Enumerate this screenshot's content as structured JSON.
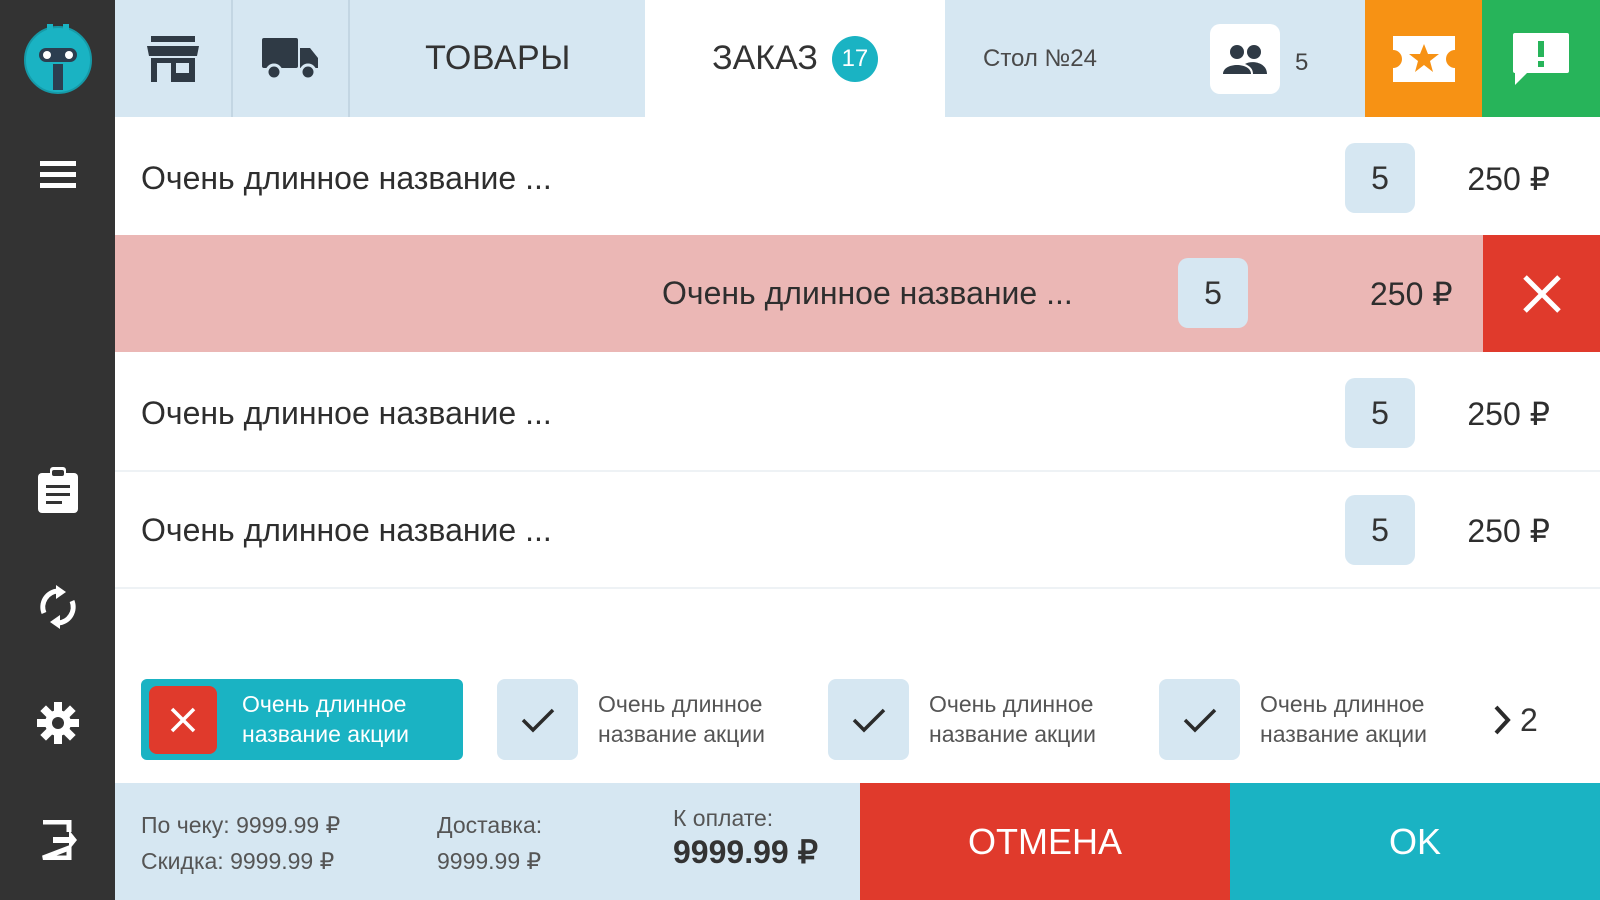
{
  "sidebar": {
    "logo": "robot-logo",
    "items": [
      {
        "icon": "menu-icon"
      },
      {
        "icon": "clipboard-icon"
      },
      {
        "icon": "sync-icon"
      },
      {
        "icon": "gear-icon"
      },
      {
        "icon": "logout-icon"
      }
    ]
  },
  "topbar": {
    "store_icon": "store-icon",
    "delivery_icon": "truck-icon",
    "goods_tab": "ТОВАРЫ",
    "order_tab": "ЗАКАЗ",
    "order_count": "17",
    "table_label": "Стол №24",
    "guests_icon": "people-icon",
    "guests_count": "5",
    "favorite_icon": "star-ticket-icon",
    "message_icon": "message-alert-icon"
  },
  "order_items": [
    {
      "name": "Очень длинное название ...",
      "qty": "5",
      "price": "250 ₽"
    },
    {
      "name": "Очень длинное название ...",
      "qty": "5",
      "price": "250 ₽",
      "swiped": true
    },
    {
      "name": "Очень длинное название ...",
      "qty": "5",
      "price": "250 ₽"
    },
    {
      "name": "Очень длинное название ...",
      "qty": "5",
      "price": "250 ₽"
    }
  ],
  "promotions": [
    {
      "label": "Очень длинное название акции",
      "active": true
    },
    {
      "label": "Очень длинное название акции",
      "active": false
    },
    {
      "label": "Очень длинное название акции",
      "active": false
    },
    {
      "label": "Очень длинное название акции",
      "active": false
    }
  ],
  "promotions_more": "2",
  "summary": {
    "receipt": "По чеку: 9999.99 ₽",
    "discount": "Скидка: 9999.99 ₽",
    "delivery_label": "Доставка:",
    "delivery_value": "9999.99 ₽",
    "to_pay_label": "К оплате:",
    "to_pay_value": "9999.99 ₽"
  },
  "actions": {
    "cancel": "ОТМЕНА",
    "ok": "OK"
  },
  "colors": {
    "sidebar": "#333333",
    "panel": "#d6e7f2",
    "accent": "#1ab3c3",
    "danger": "#e03a2c",
    "orange": "#f79214",
    "green": "#27b45a",
    "swiped_row": "#ebb7b5"
  }
}
